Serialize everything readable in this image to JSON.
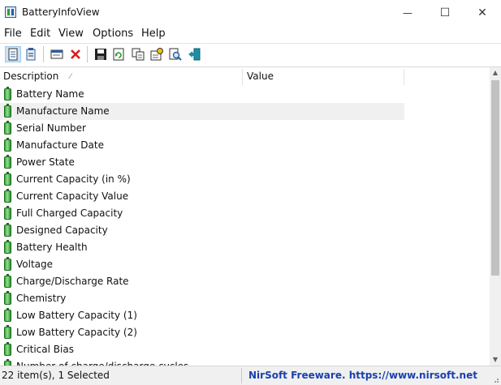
{
  "window": {
    "title": "BatteryInfoView",
    "minimize_glyph": "—",
    "maximize_glyph": "☐",
    "close_glyph": "✕"
  },
  "menu": {
    "items": [
      {
        "label": "File"
      },
      {
        "label": "Edit"
      },
      {
        "label": "View"
      },
      {
        "label": "Options"
      },
      {
        "label": "Help"
      }
    ]
  },
  "toolbar": {
    "buttons": [
      {
        "icon": "battery-info-mode-icon",
        "pressed": true
      },
      {
        "icon": "battery-log-mode-icon",
        "pressed": false
      },
      {
        "icon": "properties-window-icon",
        "pressed": false
      },
      {
        "icon": "delete-icon",
        "pressed": false
      },
      {
        "icon": "save-icon",
        "pressed": false
      },
      {
        "icon": "refresh-icon",
        "pressed": false
      },
      {
        "icon": "copy-icon",
        "pressed": false
      },
      {
        "icon": "html-report-icon",
        "pressed": false
      },
      {
        "icon": "find-icon",
        "pressed": false
      },
      {
        "icon": "exit-icon",
        "pressed": false
      }
    ]
  },
  "list": {
    "columns": [
      {
        "label": "Description"
      },
      {
        "label": "Value"
      }
    ],
    "rows": [
      {
        "description": "Battery Name",
        "value": ""
      },
      {
        "description": "Manufacture Name",
        "value": "",
        "selected": true
      },
      {
        "description": "Serial Number",
        "value": ""
      },
      {
        "description": "Manufacture Date",
        "value": ""
      },
      {
        "description": "Power State",
        "value": ""
      },
      {
        "description": "Current Capacity (in %)",
        "value": ""
      },
      {
        "description": "Current Capacity Value",
        "value": ""
      },
      {
        "description": "Full Charged Capacity",
        "value": ""
      },
      {
        "description": "Designed Capacity",
        "value": ""
      },
      {
        "description": "Battery Health",
        "value": ""
      },
      {
        "description": "Voltage",
        "value": ""
      },
      {
        "description": "Charge/Discharge Rate",
        "value": ""
      },
      {
        "description": "Chemistry",
        "value": ""
      },
      {
        "description": "Low Battery Capacity (1)",
        "value": ""
      },
      {
        "description": "Low Battery Capacity (2)",
        "value": ""
      },
      {
        "description": "Critical Bias",
        "value": ""
      },
      {
        "description": "Number of charge/discharge cycles",
        "value": ""
      }
    ]
  },
  "status": {
    "items_text": "22 item(s), 1 Selected",
    "link_text": "NirSoft Freeware. https://www.nirsoft.net"
  },
  "colors": {
    "selected_row": "#f0f0f0",
    "link": "#1a3fb0",
    "battery_icon": "#3da93d"
  }
}
